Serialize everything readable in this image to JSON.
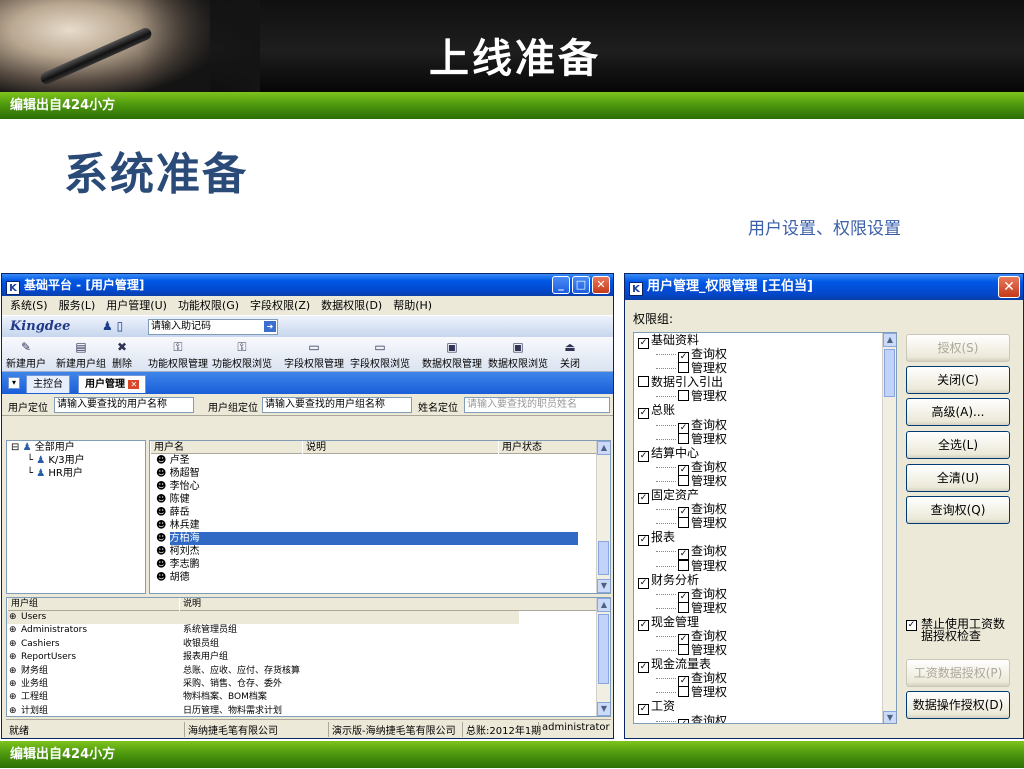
{
  "slide": {
    "title": "上线准备",
    "top_bar": "编辑出自424小方",
    "bottom_bar": "编辑出自424小方",
    "subtitle": "系统准备",
    "caption": "用户设置、权限设置"
  },
  "window1": {
    "title": "基础平台 - [用户管理]",
    "menu": [
      "系统(S)",
      "服务(L)",
      "用户管理(U)",
      "功能权限(G)",
      "字段权限(Z)",
      "数据权限(D)",
      "帮助(H)"
    ],
    "brand": "Kingdee",
    "helper_input": "请输入助记码",
    "toolbar": [
      "新建用户",
      "新建用户组",
      "删除",
      "功能权限管理",
      "功能权限浏览",
      "字段权限管理",
      "字段权限浏览",
      "数据权限管理",
      "数据权限浏览",
      "关闭"
    ],
    "tabs": [
      "主控台",
      "用户管理"
    ],
    "locate": {
      "user_label": "用户定位",
      "user_value": "请输入要查找的用户名称",
      "group_label": "用户组定位",
      "group_value": "请输入要查找的用户组名称",
      "name_label": "姓名定位",
      "name_placeholder": "请输入要查找的职员姓名"
    },
    "tree": [
      "全部用户",
      "K/3用户",
      "HR用户"
    ],
    "user_cols": [
      "用户名",
      "说明",
      "用户状态"
    ],
    "users": [
      "卢圣",
      "杨超智",
      "李怡心",
      "陈健",
      "薛岳",
      "林兵建",
      "方柏海",
      "柯刘杰",
      "李志鹏",
      "胡德"
    ],
    "selected_user": "方柏海",
    "group_cols": [
      "用户组",
      "说明"
    ],
    "groups": [
      {
        "name": "Users",
        "desc": ""
      },
      {
        "name": "Administrators",
        "desc": "系统管理员组"
      },
      {
        "name": "Cashiers",
        "desc": "收银员组"
      },
      {
        "name": "ReportUsers",
        "desc": "报表用户组"
      },
      {
        "name": "财务组",
        "desc": "总账、应收、应付、存货核算"
      },
      {
        "name": "业务组",
        "desc": "采购、销售、仓存、委外"
      },
      {
        "name": "工程组",
        "desc": "物料档案、BOM档案"
      },
      {
        "name": "计划组",
        "desc": "日历管理、物料需求计划"
      }
    ],
    "status": [
      "就绪",
      "海纳捷毛笔有限公司",
      "演示版-海纳捷毛笔有限公司",
      "总账:2012年1期",
      "administrator"
    ]
  },
  "window2": {
    "title": "用户管理_权限管理 [王伯当]",
    "group_label": "权限组:",
    "permissions": [
      {
        "name": "基础资料",
        "checked": true,
        "subs": [
          {
            "name": "查询权",
            "checked": true
          },
          {
            "name": "管理权",
            "checked": false
          }
        ]
      },
      {
        "name": "数据引入引出",
        "checked": false,
        "subs": [
          {
            "name": "管理权",
            "checked": false
          }
        ]
      },
      {
        "name": "总账",
        "checked": true,
        "subs": [
          {
            "name": "查询权",
            "checked": true
          },
          {
            "name": "管理权",
            "checked": false
          }
        ]
      },
      {
        "name": "结算中心",
        "checked": true,
        "subs": [
          {
            "name": "查询权",
            "checked": true
          },
          {
            "name": "管理权",
            "checked": false
          }
        ]
      },
      {
        "name": "固定资产",
        "checked": true,
        "subs": [
          {
            "name": "查询权",
            "checked": true
          },
          {
            "name": "管理权",
            "checked": false
          }
        ]
      },
      {
        "name": "报表",
        "checked": true,
        "subs": [
          {
            "name": "查询权",
            "checked": true
          },
          {
            "name": "管理权",
            "checked": false
          }
        ]
      },
      {
        "name": "财务分析",
        "checked": true,
        "subs": [
          {
            "name": "查询权",
            "checked": true
          },
          {
            "name": "管理权",
            "checked": false
          }
        ]
      },
      {
        "name": "现金管理",
        "checked": true,
        "subs": [
          {
            "name": "查询权",
            "checked": true
          },
          {
            "name": "管理权",
            "checked": false
          }
        ]
      },
      {
        "name": "现金流量表",
        "checked": true,
        "subs": [
          {
            "name": "查询权",
            "checked": true
          },
          {
            "name": "管理权",
            "checked": false
          }
        ]
      },
      {
        "name": "工资",
        "checked": true,
        "subs": [
          {
            "name": "查询权",
            "checked": true
          }
        ]
      }
    ],
    "buttons": {
      "grant": "授权(S)",
      "close": "关闭(C)",
      "advanced": "高级(A)...",
      "select_all": "全选(L)",
      "clear_all": "全清(U)",
      "query": "查询权(Q)",
      "wage_grant": "工资数据授权(P)",
      "data_op": "数据操作授权(D)"
    },
    "wage_check_label": "禁止使用工资数据授权检查",
    "wage_check_checked": true
  }
}
